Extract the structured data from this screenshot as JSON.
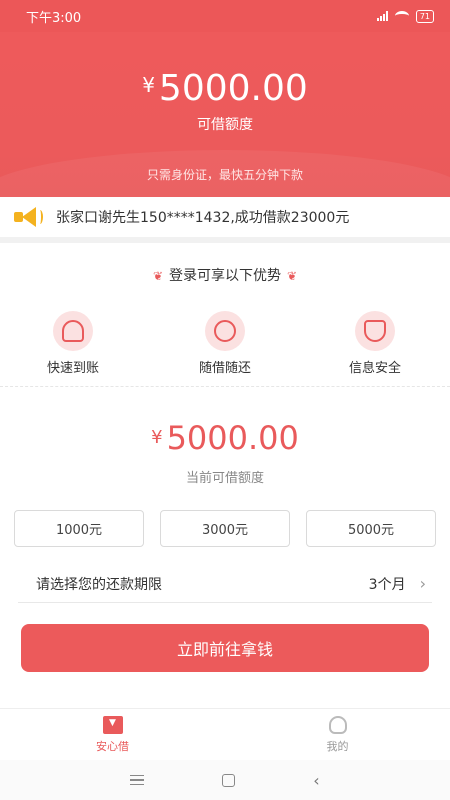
{
  "status": {
    "time": "下午3:00",
    "battery": "71"
  },
  "hero": {
    "currency": "¥",
    "amount": "5000.00",
    "label": "可借额度",
    "note": "只需身份证，最快五分钟下款"
  },
  "notice": {
    "text": "张家口谢先生150****1432,成功借款23000元"
  },
  "advantages": {
    "title": "登录可享以下优势",
    "items": [
      {
        "label": "快速到账",
        "icon": "rocket-icon"
      },
      {
        "label": "随借随还",
        "icon": "cycle-icon"
      },
      {
        "label": "信息安全",
        "icon": "shield-icon"
      }
    ]
  },
  "loan": {
    "currency": "¥",
    "amount": "5000.00",
    "label": "当前可借额度",
    "options": [
      "1000元",
      "3000元",
      "5000元"
    ],
    "period_label": "请选择您的还款期限",
    "period_value": "3个月",
    "cta": "立即前往拿钱"
  },
  "tabbar": {
    "home": "安心借",
    "mine": "我的"
  },
  "colors": {
    "accent": "#ec5a5b"
  }
}
